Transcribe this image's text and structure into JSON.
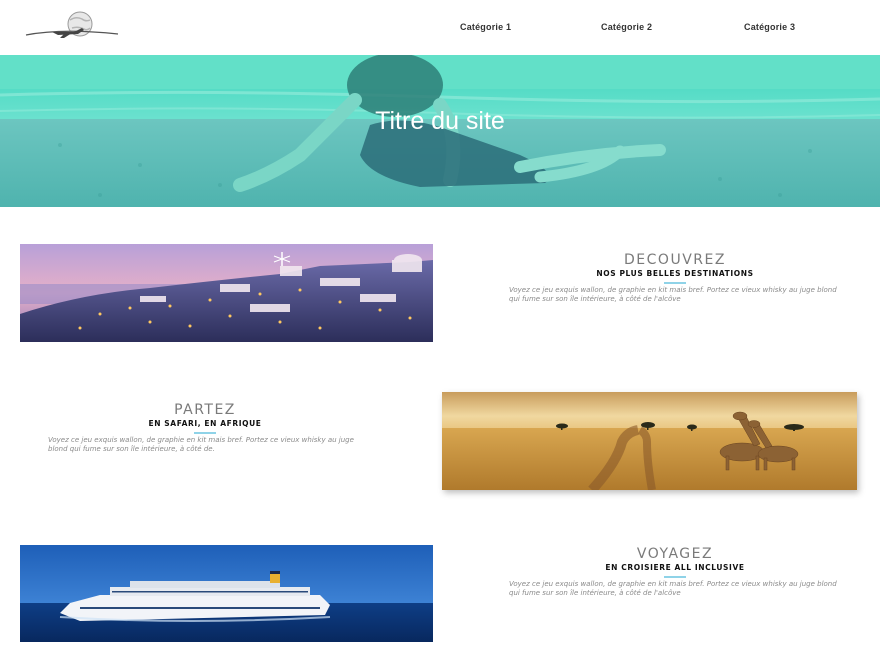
{
  "header": {
    "logo": "globe-airplane-logo",
    "nav": [
      "Catégorie 1",
      "Catégorie 2",
      "Catégorie 3"
    ]
  },
  "hero": {
    "title": "Titre du site"
  },
  "sections": [
    {
      "title": "DECOUVREZ",
      "subtitle": "NOS PLUS BELLES DESTINATIONS",
      "text": "Voyez ce jeu exquis wallon, de graphie en kit mais bref. Portez ce vieux whisky au juge blond qui fume sur son île intérieure, à côté de l'alcôve",
      "image": "santorini-photo"
    },
    {
      "title": "PARTEZ",
      "subtitle": "EN SAFARI, EN AFRIQUE",
      "text": "Voyez ce jeu exquis wallon, de graphie en kit mais bref. Portez ce vieux whisky au juge blond qui fume sur son île intérieure, à côté de.",
      "image": "safari-giraffes-photo"
    },
    {
      "title": "VOYAGEZ",
      "subtitle": "EN CROISIERE ALL INCLUSIVE",
      "text": "Voyez ce jeu exquis wallon, de graphie en kit mais bref. Portez ce vieux whisky au juge blond qui fume sur son île intérieure, à côté de l'alcôve",
      "image": "cruise-ship-photo"
    }
  ],
  "colors": {
    "hero_overlay": "#5fe0c8",
    "accent_line": "#8fd3e8",
    "heading_gray": "#7a7a7a"
  }
}
